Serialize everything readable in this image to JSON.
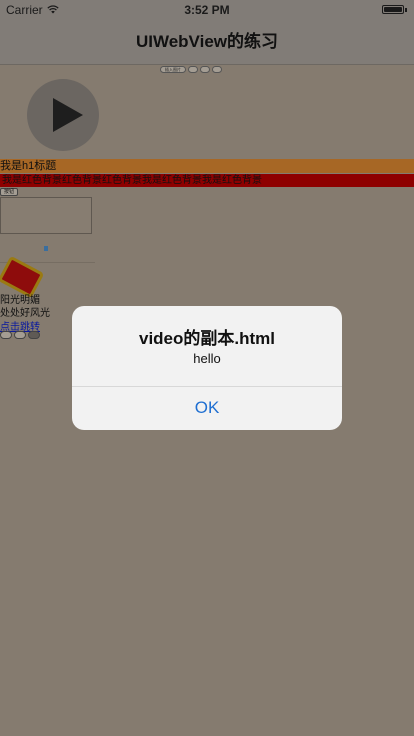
{
  "status_bar": {
    "carrier": "Carrier",
    "time": "3:52 PM",
    "battery_level": 1.0
  },
  "nav": {
    "title": "UIWebView的练习"
  },
  "web_content": {
    "top_buttons": [
      "插入图片",
      "",
      "",
      ""
    ],
    "h1_label": "我是h1标题",
    "red_text": "我是红色背景红色背景红色背景我是红色背景我是红色背景",
    "small_button": "按钮",
    "caption1": "阳光明媚",
    "caption2": "处处好风光",
    "link_text": "点击跳转",
    "bottom_buttons": [
      "",
      "",
      ""
    ]
  },
  "alert": {
    "title": "video的副本.html",
    "message": "hello",
    "ok_label": "OK"
  }
}
